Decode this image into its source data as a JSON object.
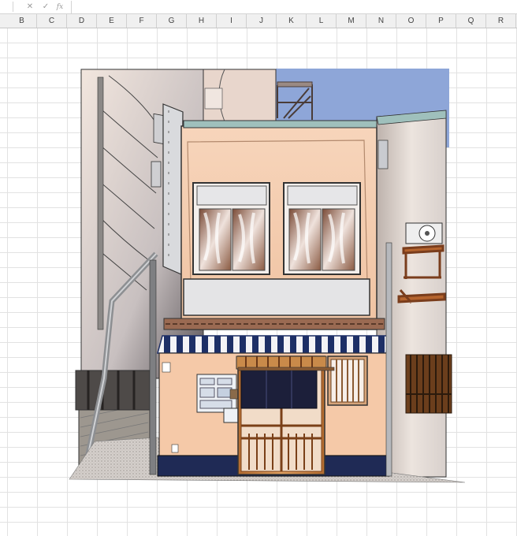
{
  "formula_bar": {
    "cancel_icon": "close-icon",
    "enter_icon": "check-icon",
    "function_icon": "fx-icon",
    "cancel_glyph": "✕",
    "enter_glyph": "✓",
    "function_glyph": "fx",
    "value": ""
  },
  "columns": [
    "B",
    "C",
    "D",
    "E",
    "F",
    "G",
    "H",
    "I",
    "J",
    "K",
    "L",
    "M",
    "N",
    "O",
    "P",
    "Q",
    "R"
  ],
  "colors": {
    "sky": "#8ea6d8",
    "wall": "#f4cdb0",
    "awning_blue": "#1d2f66",
    "noren": "#1c1f3a",
    "door_wood": "#c98a4a"
  }
}
